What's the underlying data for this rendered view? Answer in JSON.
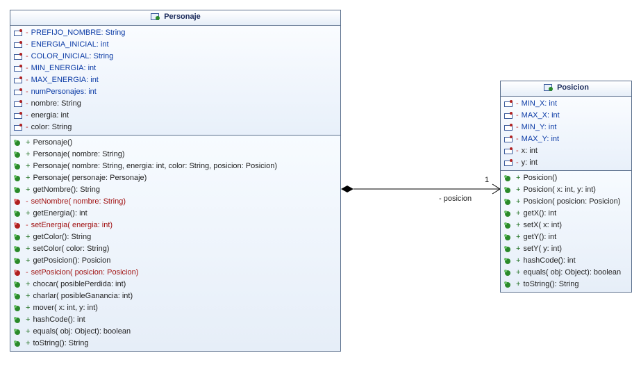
{
  "classes": {
    "personaje": {
      "name": "Personaje",
      "attributes": [
        {
          "vis": "-",
          "name": "PREFIJO_NOMBRE: String",
          "static": true
        },
        {
          "vis": "-",
          "name": "ENERGIA_INICIAL: int",
          "static": true
        },
        {
          "vis": "-",
          "name": "COLOR_INICIAL: String",
          "static": true
        },
        {
          "vis": "-",
          "name": "MIN_ENERGIA: int",
          "static": true
        },
        {
          "vis": "-",
          "name": "MAX_ENERGIA: int",
          "static": true
        },
        {
          "vis": "-",
          "name": "numPersonajes: int",
          "static": true
        },
        {
          "vis": "-",
          "name": "nombre: String",
          "static": false
        },
        {
          "vis": "-",
          "name": "energia: int",
          "static": false
        },
        {
          "vis": "-",
          "name": "color: String",
          "static": false
        }
      ],
      "operations": [
        {
          "vis": "+",
          "sig": "Personaje()"
        },
        {
          "vis": "+",
          "sig": "Personaje(  nombre: String)"
        },
        {
          "vis": "+",
          "sig": "Personaje(  nombre: String,   energia: int,   color: String,   posicion: Posicion)"
        },
        {
          "vis": "+",
          "sig": "Personaje(  personaje: Personaje)"
        },
        {
          "vis": "+",
          "sig": "getNombre(): String"
        },
        {
          "vis": "-",
          "sig": "setNombre(  nombre: String)"
        },
        {
          "vis": "+",
          "sig": "getEnergia(): int"
        },
        {
          "vis": "-",
          "sig": "setEnergia(  energia: int)"
        },
        {
          "vis": "+",
          "sig": "getColor(): String"
        },
        {
          "vis": "+",
          "sig": "setColor(  color: String)"
        },
        {
          "vis": "+",
          "sig": "getPosicion(): Posicion"
        },
        {
          "vis": "-",
          "sig": "setPosicion(  posicion: Posicion)"
        },
        {
          "vis": "+",
          "sig": "chocar(  posiblePerdida: int)"
        },
        {
          "vis": "+",
          "sig": "charlar(  posibleGanancia: int)"
        },
        {
          "vis": "+",
          "sig": "mover(  x: int,   y: int)"
        },
        {
          "vis": "+",
          "sig": "hashCode(): int"
        },
        {
          "vis": "+",
          "sig": "equals(  obj: Object): boolean"
        },
        {
          "vis": "+",
          "sig": "toString(): String"
        }
      ]
    },
    "posicion": {
      "name": "Posicion",
      "attributes": [
        {
          "vis": "-",
          "name": "MIN_X: int",
          "static": true
        },
        {
          "vis": "-",
          "name": "MAX_X: int",
          "static": true
        },
        {
          "vis": "-",
          "name": "MIN_Y: int",
          "static": true
        },
        {
          "vis": "-",
          "name": "MAX_Y: int",
          "static": true
        },
        {
          "vis": "-",
          "name": "x: int",
          "static": false
        },
        {
          "vis": "-",
          "name": "y: int",
          "static": false
        }
      ],
      "operations": [
        {
          "vis": "+",
          "sig": "Posicion()"
        },
        {
          "vis": "+",
          "sig": "Posicion(  x: int,   y: int)"
        },
        {
          "vis": "+",
          "sig": "Posicion(  posicion: Posicion)"
        },
        {
          "vis": "+",
          "sig": "getX(): int"
        },
        {
          "vis": "+",
          "sig": "setX(  x: int)"
        },
        {
          "vis": "+",
          "sig": "getY(): int"
        },
        {
          "vis": "+",
          "sig": "setY(  y: int)"
        },
        {
          "vis": "+",
          "sig": "hashCode(): int"
        },
        {
          "vis": "+",
          "sig": "equals(  obj: Object): boolean"
        },
        {
          "vis": "+",
          "sig": "toString(): String"
        }
      ]
    }
  },
  "association": {
    "role": "- posicion",
    "multiplicity": "1"
  }
}
